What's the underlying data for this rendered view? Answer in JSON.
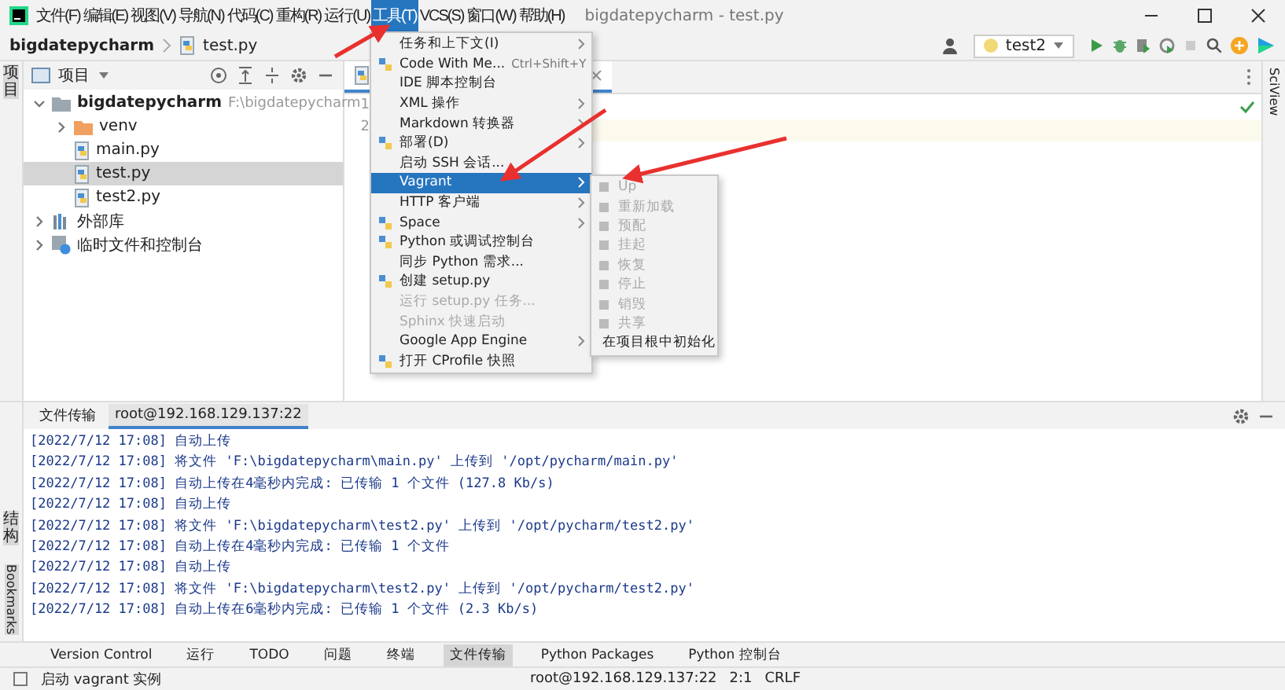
{
  "window": {
    "title": "bigdatepycharm - test.py"
  },
  "menubar": [
    {
      "label": "文件(F)",
      "selected": false
    },
    {
      "label": "编辑(E)",
      "selected": false
    },
    {
      "label": "视图(V)",
      "selected": false
    },
    {
      "label": "导航(N)",
      "selected": false
    },
    {
      "label": "代码(C)",
      "selected": false
    },
    {
      "label": "重构(R)",
      "selected": false
    },
    {
      "label": "运行(U)",
      "selected": false
    },
    {
      "label": "工具(T)",
      "selected": true
    },
    {
      "label": "VCS(S)",
      "selected": false
    },
    {
      "label": "窗口(W)",
      "selected": false
    },
    {
      "label": "帮助(H)",
      "selected": false
    }
  ],
  "breadcrumb": [
    "bigdatepycharm",
    "test.py"
  ],
  "run_config": "test2",
  "project_panel": {
    "title": "项目",
    "side_label": "项目",
    "tree": [
      {
        "name": "bigdatepycharm",
        "path": "F:\\bigdatepycharm",
        "kind": "project",
        "expanded": true,
        "selected": false,
        "children": [
          {
            "name": "venv",
            "kind": "folder",
            "expanded": false,
            "selected": false
          },
          {
            "name": "main.py",
            "kind": "file",
            "selected": false
          },
          {
            "name": "test.py",
            "kind": "file",
            "selected": true
          },
          {
            "name": "test2.py",
            "kind": "file",
            "selected": false
          }
        ]
      },
      {
        "name": "外部库",
        "kind": "library",
        "expanded": false,
        "selected": false
      },
      {
        "name": "临时文件和控制台",
        "kind": "scratch",
        "expanded": false,
        "selected": false
      }
    ]
  },
  "editor": {
    "line_numbers": [
      "1",
      "2"
    ],
    "side_label": "SciView"
  },
  "tools_menu": [
    {
      "label": "任务和上下文(I)",
      "kind": "plain",
      "submenu": true,
      "disabled": false,
      "selected": false
    },
    {
      "label": "Code With Me...",
      "kind": "icon",
      "shortcut": "Ctrl+Shift+Y",
      "submenu": false,
      "disabled": false,
      "selected": false
    },
    {
      "label": "IDE 脚本控制台",
      "kind": "plain",
      "submenu": false,
      "disabled": false,
      "selected": false
    },
    {
      "label": "XML 操作",
      "kind": "plain",
      "submenu": true,
      "disabled": false,
      "selected": false
    },
    {
      "label": "Markdown 转换器",
      "kind": "plain",
      "submenu": true,
      "disabled": false,
      "selected": false
    },
    {
      "label": "部署(D)",
      "kind": "icon",
      "submenu": true,
      "disabled": false,
      "selected": false
    },
    {
      "label": "启动 SSH 会话...",
      "kind": "plain",
      "submenu": false,
      "disabled": false,
      "selected": false
    },
    {
      "label": "Vagrant",
      "kind": "plain",
      "submenu": true,
      "disabled": false,
      "selected": true
    },
    {
      "label": "HTTP 客户端",
      "kind": "plain",
      "submenu": true,
      "disabled": false,
      "selected": false
    },
    {
      "label": "Space",
      "kind": "icon",
      "submenu": true,
      "disabled": false,
      "selected": false
    },
    {
      "label": "Python 或调试控制台",
      "kind": "icon",
      "submenu": false,
      "disabled": false,
      "selected": false
    },
    {
      "label": "同步 Python 需求...",
      "kind": "plain",
      "submenu": false,
      "disabled": false,
      "selected": false
    },
    {
      "label": "创建 setup.py",
      "kind": "icon",
      "submenu": false,
      "disabled": false,
      "selected": false
    },
    {
      "label": "运行 setup.py 任务...",
      "kind": "plain",
      "submenu": false,
      "disabled": true,
      "selected": false
    },
    {
      "label": "Sphinx 快速启动",
      "kind": "plain",
      "submenu": false,
      "disabled": true,
      "selected": false
    },
    {
      "label": "Google App Engine",
      "kind": "plain",
      "submenu": true,
      "disabled": false,
      "selected": false
    },
    {
      "label": "打开 CProfile 快照",
      "kind": "icon",
      "submenu": false,
      "disabled": false,
      "selected": false
    }
  ],
  "vagrant_submenu": [
    {
      "label": "Up",
      "disabled": true
    },
    {
      "label": "重新加载",
      "disabled": true
    },
    {
      "label": "预配",
      "disabled": true
    },
    {
      "label": "挂起",
      "disabled": true
    },
    {
      "label": "恢复",
      "disabled": true
    },
    {
      "label": "停止",
      "disabled": true
    },
    {
      "label": "销毁",
      "disabled": true
    },
    {
      "label": "共享",
      "disabled": true
    },
    {
      "label": "在项目根中初始化",
      "disabled": false
    }
  ],
  "bottom_panel": {
    "tabs": [
      {
        "label": "文件传输",
        "selected": false
      },
      {
        "label": "root@192.168.129.137:22",
        "selected": true
      }
    ],
    "side_labels": [
      "结构",
      "Bookmarks"
    ],
    "console": [
      "[2022/7/12 17:08] 自动上传",
      "[2022/7/12 17:08] 将文件 'F:\\bigdatepycharm\\main.py' 上传到 '/opt/pycharm/main.py'",
      "[2022/7/12 17:08] 自动上传在4毫秒内完成: 已传输 1 个文件 (127.8 Kb/s)",
      "[2022/7/12 17:08] 自动上传",
      "[2022/7/12 17:08] 将文件 'F:\\bigdatepycharm\\test2.py' 上传到 '/opt/pycharm/test2.py'",
      "[2022/7/12 17:08] 自动上传在4毫秒内完成: 已传输 1 个文件",
      "[2022/7/12 17:08] 自动上传",
      "[2022/7/12 17:08] 将文件 'F:\\bigdatepycharm\\test2.py' 上传到 '/opt/pycharm/test2.py'",
      "[2022/7/12 17:08] 自动上传在6毫秒内完成: 已传输 1 个文件 (2.3 Kb/s)"
    ]
  },
  "tool_windows": [
    {
      "label": "Version Control",
      "selected": false
    },
    {
      "label": "运行",
      "selected": false
    },
    {
      "label": "TODO",
      "selected": false
    },
    {
      "label": "问题",
      "selected": false
    },
    {
      "label": "终端",
      "selected": false
    },
    {
      "label": "文件传输",
      "selected": true
    },
    {
      "label": "Python Packages",
      "selected": false
    },
    {
      "label": "Python 控制台",
      "selected": false
    }
  ],
  "status_bar": {
    "message": "启动 vagrant 实例",
    "items": [
      "root@192.168.129.137:22",
      "2:1",
      "CRLF"
    ]
  }
}
